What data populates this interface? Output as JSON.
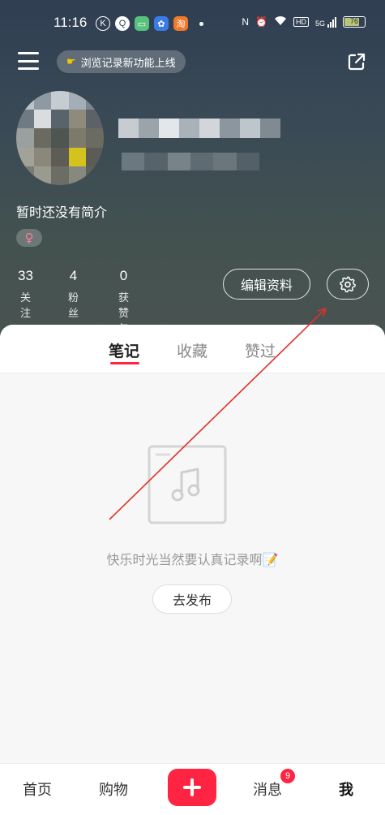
{
  "status_bar": {
    "time": "11:16",
    "app_icons": [
      "K",
      "Q",
      "chat",
      "baidu",
      "taobao"
    ],
    "network": "5G",
    "hd": "HD",
    "battery": "76"
  },
  "header": {
    "notice": "浏览记录新功能上线"
  },
  "profile": {
    "bio": "暂时还没有简介",
    "gender_symbol": "♀",
    "stats": [
      {
        "value": "33",
        "label": "关注"
      },
      {
        "value": "4",
        "label": "粉丝"
      },
      {
        "value": "0",
        "label": "获赞与收藏"
      }
    ],
    "edit_label": "编辑资料"
  },
  "tabs": [
    {
      "label": "笔记",
      "active": true
    },
    {
      "label": "收藏",
      "active": false
    },
    {
      "label": "赞过",
      "active": false
    }
  ],
  "empty_state": {
    "text": "快乐时光当然要认真记录啊📝",
    "publish_label": "去发布"
  },
  "bottom_nav": {
    "items": [
      {
        "label": "首页"
      },
      {
        "label": "购物"
      },
      {
        "label": "消息"
      },
      {
        "label": "我"
      }
    ],
    "message_badge": "9"
  },
  "colors": {
    "accent": "#ff2442",
    "annotation_line": "#e0302a"
  }
}
